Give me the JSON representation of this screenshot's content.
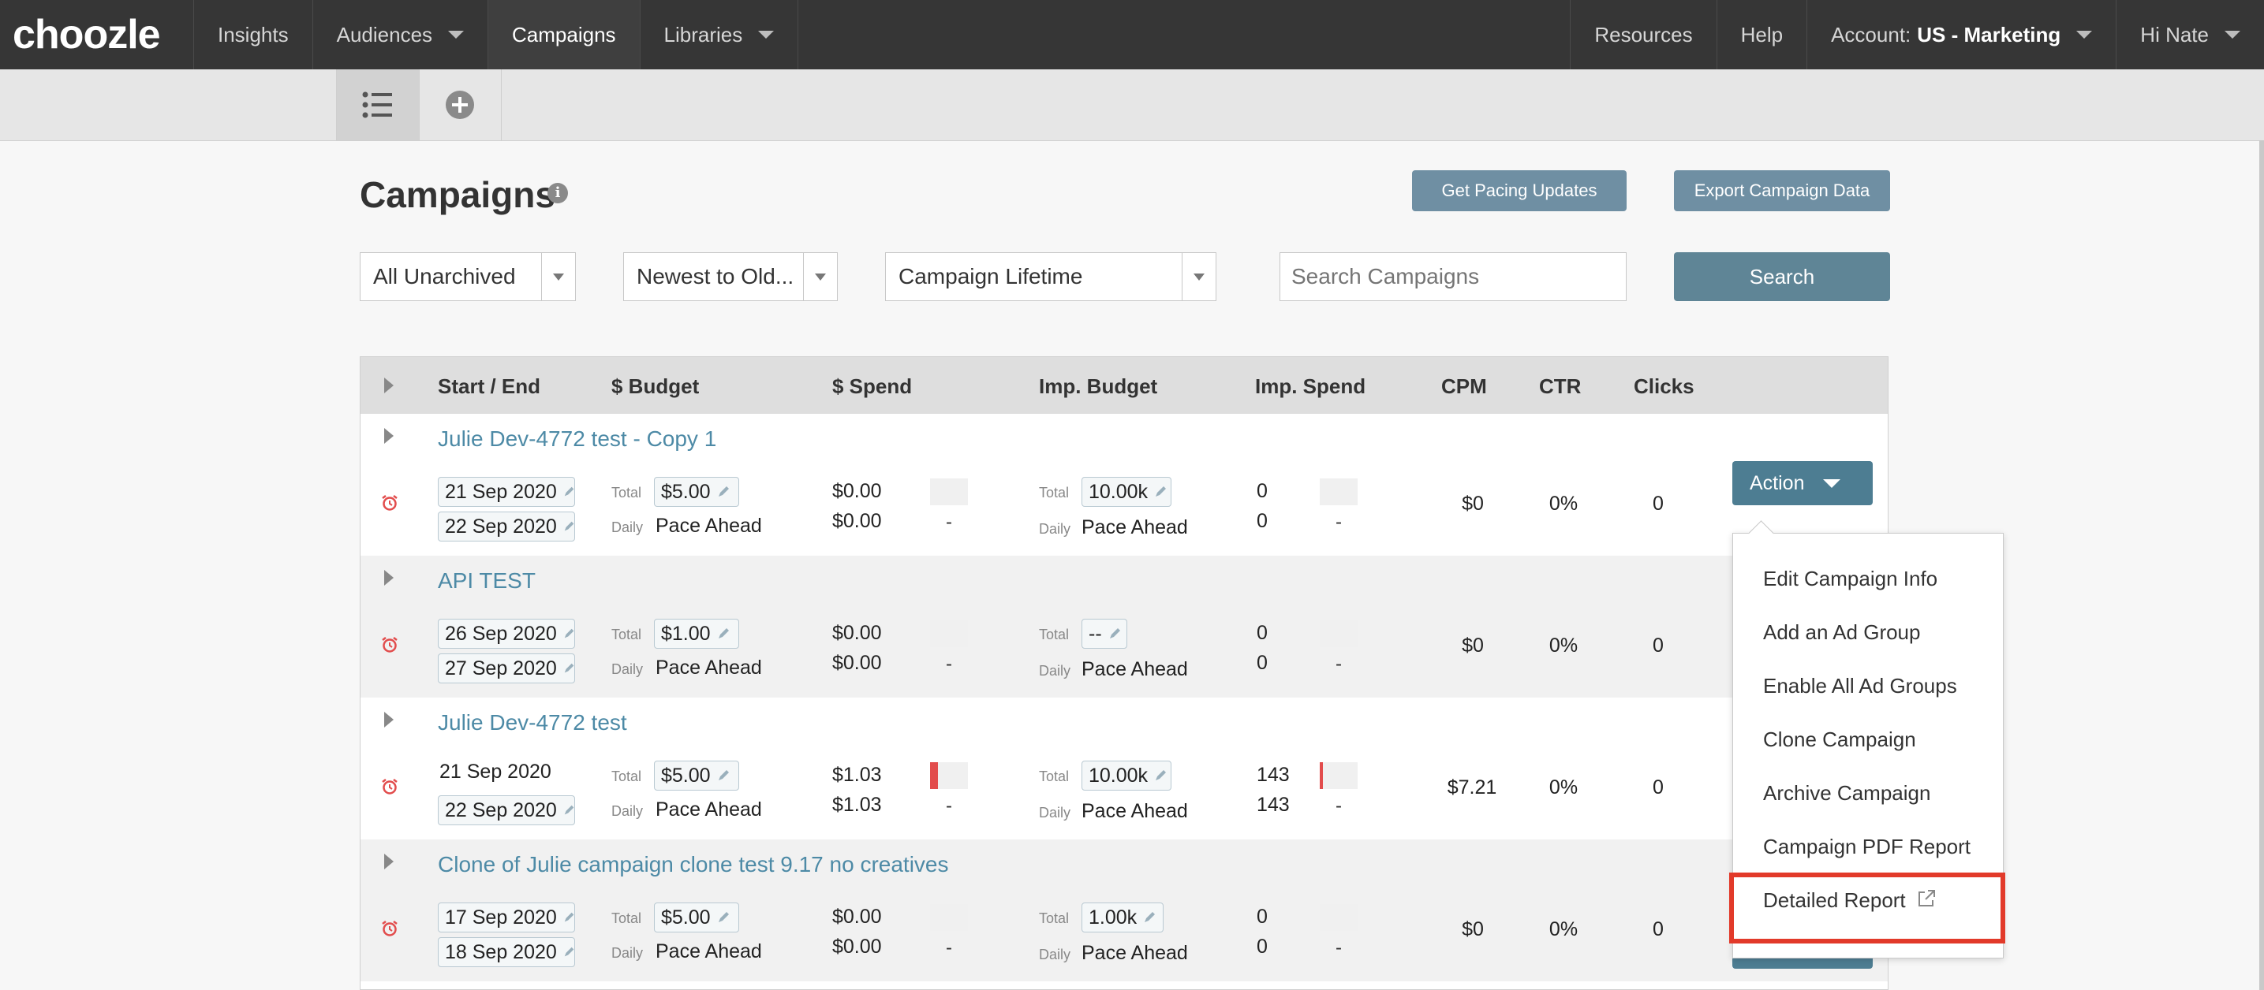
{
  "nav": {
    "logo": "choozle",
    "items": [
      "Insights",
      "Audiences",
      "Campaigns",
      "Libraries"
    ],
    "resources": "Resources",
    "help": "Help",
    "account_label": "Account:",
    "account_value": "US - Marketing",
    "user": "Hi Nate"
  },
  "page": {
    "title": "Campaigns",
    "pacing_button": "Get Pacing Updates",
    "export_button": "Export Campaign Data",
    "search_button": "Search"
  },
  "filters": {
    "archive": "All Unarchived",
    "sort": "Newest to Old...",
    "range": "Campaign Lifetime",
    "search_placeholder": "Search Campaigns"
  },
  "table": {
    "headers": [
      "Start / End",
      "$ Budget",
      "$ Spend",
      "Imp. Budget",
      "Imp. Spend",
      "CPM",
      "CTR",
      "Clicks"
    ],
    "total_label": "Total",
    "daily_label": "Daily",
    "pace_label": "Pace Ahead",
    "dash": "-",
    "action_label": "Action",
    "rows": [
      {
        "name": "Julie Dev-4772 test - Copy 1",
        "start": "21 Sep 2020",
        "end": "22 Sep 2020",
        "budget_total": "$5.00",
        "spend_total": "$0.00",
        "spend_daily": "$0.00",
        "imp_budget": "10.00k",
        "imp_spend_total": "0",
        "imp_spend_daily": "0",
        "cpm": "$0",
        "ctr": "0%",
        "clicks": "0",
        "spend_progress": 0,
        "imp_progress": 0
      },
      {
        "name": "API TEST",
        "start": "26 Sep 2020",
        "end": "27 Sep 2020",
        "budget_total": "$1.00",
        "spend_total": "$0.00",
        "spend_daily": "$0.00",
        "imp_budget": "--",
        "imp_spend_total": "0",
        "imp_spend_daily": "0",
        "cpm": "$0",
        "ctr": "0%",
        "clicks": "0",
        "spend_progress": 0,
        "imp_progress": 0
      },
      {
        "name": "Julie Dev-4772 test",
        "start": "21 Sep 2020",
        "end": "22 Sep 2020",
        "budget_total": "$5.00",
        "spend_total": "$1.03",
        "spend_daily": "$1.03",
        "imp_budget": "10.00k",
        "imp_spend_total": "143",
        "imp_spend_daily": "143",
        "cpm": "$7.21",
        "ctr": "0%",
        "clicks": "0",
        "spend_progress": 0.21,
        "imp_progress": 0.0143
      },
      {
        "name": "Clone of Julie campaign clone test 9.17 no creatives",
        "start": "17 Sep 2020",
        "end": "18 Sep 2020",
        "budget_total": "$5.00",
        "spend_total": "$0.00",
        "spend_daily": "$0.00",
        "imp_budget": "1.00k",
        "imp_spend_total": "0",
        "imp_spend_daily": "0",
        "cpm": "$0",
        "ctr": "0%",
        "clicks": "0",
        "spend_progress": 0,
        "imp_progress": 0
      }
    ]
  },
  "action_menu": {
    "items": [
      "Edit Campaign Info",
      "Add an Ad Group",
      "Enable All Ad Groups",
      "Clone Campaign",
      "Archive Campaign",
      "Campaign PDF Report",
      "Detailed Report"
    ]
  },
  "colors": {
    "topbar": "#363636",
    "accent_teal": "#4d7d92",
    "link": "#4d8aa6",
    "alert_red": "#e23a2a"
  }
}
